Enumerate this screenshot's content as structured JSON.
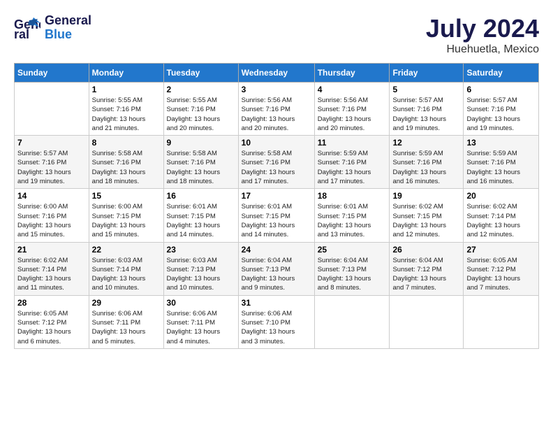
{
  "header": {
    "logo_line1": "General",
    "logo_line2": "Blue",
    "title": "July 2024",
    "location": "Huehuetla, Mexico"
  },
  "days_of_week": [
    "Sunday",
    "Monday",
    "Tuesday",
    "Wednesday",
    "Thursday",
    "Friday",
    "Saturday"
  ],
  "weeks": [
    [
      {
        "day": "",
        "info": ""
      },
      {
        "day": "1",
        "info": "Sunrise: 5:55 AM\nSunset: 7:16 PM\nDaylight: 13 hours\nand 21 minutes."
      },
      {
        "day": "2",
        "info": "Sunrise: 5:55 AM\nSunset: 7:16 PM\nDaylight: 13 hours\nand 20 minutes."
      },
      {
        "day": "3",
        "info": "Sunrise: 5:56 AM\nSunset: 7:16 PM\nDaylight: 13 hours\nand 20 minutes."
      },
      {
        "day": "4",
        "info": "Sunrise: 5:56 AM\nSunset: 7:16 PM\nDaylight: 13 hours\nand 20 minutes."
      },
      {
        "day": "5",
        "info": "Sunrise: 5:57 AM\nSunset: 7:16 PM\nDaylight: 13 hours\nand 19 minutes."
      },
      {
        "day": "6",
        "info": "Sunrise: 5:57 AM\nSunset: 7:16 PM\nDaylight: 13 hours\nand 19 minutes."
      }
    ],
    [
      {
        "day": "7",
        "info": "Sunrise: 5:57 AM\nSunset: 7:16 PM\nDaylight: 13 hours\nand 19 minutes."
      },
      {
        "day": "8",
        "info": "Sunrise: 5:58 AM\nSunset: 7:16 PM\nDaylight: 13 hours\nand 18 minutes."
      },
      {
        "day": "9",
        "info": "Sunrise: 5:58 AM\nSunset: 7:16 PM\nDaylight: 13 hours\nand 18 minutes."
      },
      {
        "day": "10",
        "info": "Sunrise: 5:58 AM\nSunset: 7:16 PM\nDaylight: 13 hours\nand 17 minutes."
      },
      {
        "day": "11",
        "info": "Sunrise: 5:59 AM\nSunset: 7:16 PM\nDaylight: 13 hours\nand 17 minutes."
      },
      {
        "day": "12",
        "info": "Sunrise: 5:59 AM\nSunset: 7:16 PM\nDaylight: 13 hours\nand 16 minutes."
      },
      {
        "day": "13",
        "info": "Sunrise: 5:59 AM\nSunset: 7:16 PM\nDaylight: 13 hours\nand 16 minutes."
      }
    ],
    [
      {
        "day": "14",
        "info": "Sunrise: 6:00 AM\nSunset: 7:16 PM\nDaylight: 13 hours\nand 15 minutes."
      },
      {
        "day": "15",
        "info": "Sunrise: 6:00 AM\nSunset: 7:15 PM\nDaylight: 13 hours\nand 15 minutes."
      },
      {
        "day": "16",
        "info": "Sunrise: 6:01 AM\nSunset: 7:15 PM\nDaylight: 13 hours\nand 14 minutes."
      },
      {
        "day": "17",
        "info": "Sunrise: 6:01 AM\nSunset: 7:15 PM\nDaylight: 13 hours\nand 14 minutes."
      },
      {
        "day": "18",
        "info": "Sunrise: 6:01 AM\nSunset: 7:15 PM\nDaylight: 13 hours\nand 13 minutes."
      },
      {
        "day": "19",
        "info": "Sunrise: 6:02 AM\nSunset: 7:15 PM\nDaylight: 13 hours\nand 12 minutes."
      },
      {
        "day": "20",
        "info": "Sunrise: 6:02 AM\nSunset: 7:14 PM\nDaylight: 13 hours\nand 12 minutes."
      }
    ],
    [
      {
        "day": "21",
        "info": "Sunrise: 6:02 AM\nSunset: 7:14 PM\nDaylight: 13 hours\nand 11 minutes."
      },
      {
        "day": "22",
        "info": "Sunrise: 6:03 AM\nSunset: 7:14 PM\nDaylight: 13 hours\nand 10 minutes."
      },
      {
        "day": "23",
        "info": "Sunrise: 6:03 AM\nSunset: 7:13 PM\nDaylight: 13 hours\nand 10 minutes."
      },
      {
        "day": "24",
        "info": "Sunrise: 6:04 AM\nSunset: 7:13 PM\nDaylight: 13 hours\nand 9 minutes."
      },
      {
        "day": "25",
        "info": "Sunrise: 6:04 AM\nSunset: 7:13 PM\nDaylight: 13 hours\nand 8 minutes."
      },
      {
        "day": "26",
        "info": "Sunrise: 6:04 AM\nSunset: 7:12 PM\nDaylight: 13 hours\nand 7 minutes."
      },
      {
        "day": "27",
        "info": "Sunrise: 6:05 AM\nSunset: 7:12 PM\nDaylight: 13 hours\nand 7 minutes."
      }
    ],
    [
      {
        "day": "28",
        "info": "Sunrise: 6:05 AM\nSunset: 7:12 PM\nDaylight: 13 hours\nand 6 minutes."
      },
      {
        "day": "29",
        "info": "Sunrise: 6:06 AM\nSunset: 7:11 PM\nDaylight: 13 hours\nand 5 minutes."
      },
      {
        "day": "30",
        "info": "Sunrise: 6:06 AM\nSunset: 7:11 PM\nDaylight: 13 hours\nand 4 minutes."
      },
      {
        "day": "31",
        "info": "Sunrise: 6:06 AM\nSunset: 7:10 PM\nDaylight: 13 hours\nand 3 minutes."
      },
      {
        "day": "",
        "info": ""
      },
      {
        "day": "",
        "info": ""
      },
      {
        "day": "",
        "info": ""
      }
    ]
  ]
}
